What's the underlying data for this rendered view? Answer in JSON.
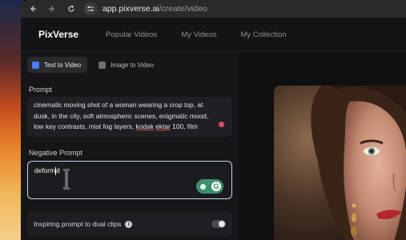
{
  "browser": {
    "url_host": "app.pixverse.ai",
    "url_path": "/create/video",
    "icons": [
      "back-arrow-icon",
      "forward-arrow-icon",
      "reload-icon",
      "site-info-icon"
    ]
  },
  "app": {
    "logo": "PixVerse",
    "nav": [
      "Popular Videos",
      "My Videos",
      "My Collection"
    ]
  },
  "panel": {
    "modes": [
      {
        "label": "Text to Video",
        "active": true,
        "color": "#4a7dff"
      },
      {
        "label": "Image to Video",
        "active": false,
        "color": "#8a8a90"
      }
    ],
    "prompt_label": "Prompt",
    "prompt_parts": {
      "line1": "cinematic moving shot of a woman wearing a crop top, at",
      "line2": "dusk, in the city, soft atmospheric scenes, enigmatic mood,",
      "line3_a": "low key contrasts, mist fog layers, ",
      "kodak": "kodak",
      "space": " ",
      "ektar": "ektar",
      "line3_b": " 100, film"
    },
    "negative_label": "Negative Prompt",
    "negative_value": "deform",
    "negative_tail": "d",
    "dual_label": "Inspiring prompt to dual clips",
    "dual_toggle_on": false
  },
  "colors": {
    "accent": "#4a7dff",
    "grammar": "#3f8f6e",
    "error": "#e04848"
  }
}
